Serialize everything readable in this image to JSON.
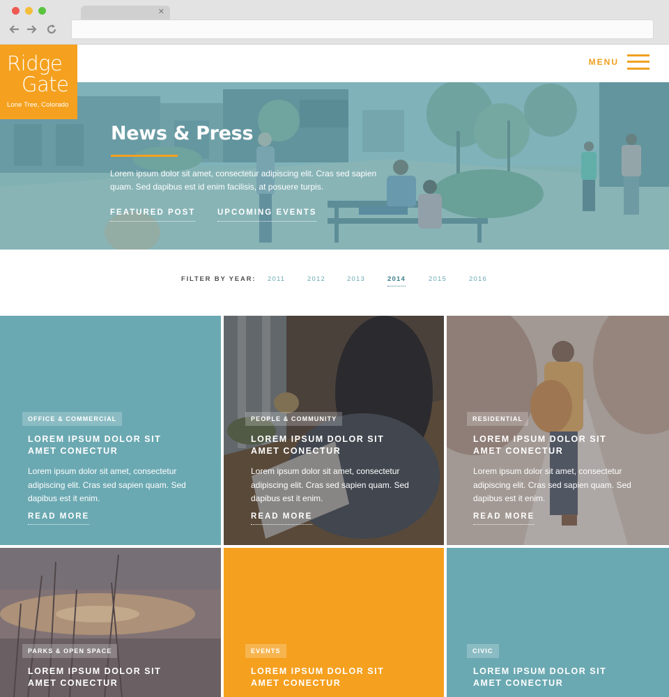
{
  "brand": {
    "name_line1": "Ridge",
    "name_line2": "Gate",
    "location": "Lone Tree, Colorado"
  },
  "header": {
    "menu_label": "MENU"
  },
  "hero": {
    "title": "News & Press",
    "description": "Lorem ipsum dolor sit amet, consectetur adipiscing elit. Cras sed sapien quam. Sed dapibus est id enim facilisis, at posuere turpis.",
    "links": [
      "FEATURED POST",
      "UPCOMING EVENTS"
    ]
  },
  "filter": {
    "label": "FILTER BY YEAR:",
    "years": [
      "2011",
      "2012",
      "2013",
      "2014",
      "2015",
      "2016"
    ],
    "active": "2014"
  },
  "tiles": [
    {
      "category": "OFFICE & COMMERCIAL",
      "title_line1": "LOREM IPSUM DOLOR SIT",
      "title_line2": "AMET CONECTUR",
      "text": "Lorem ipsum dolor sit amet, consectetur adipiscing elit. Cras sed sapien quam. Sed dapibus est it enim.",
      "more": "READ MORE"
    },
    {
      "category": "PEOPLE & COMMUNITY",
      "title_line1": "LOREM IPSUM DOLOR SIT",
      "title_line2": "AMET CONECTUR",
      "text": "Lorem ipsum dolor sit amet, consectetur adipiscing elit. Cras sed sapien quam. Sed dapibus est it enim.",
      "more": "READ MORE"
    },
    {
      "category": "RESIDENTIAL",
      "title_line1": "LOREM IPSUM DOLOR SIT",
      "title_line2": "AMET CONECTUR",
      "text": "Lorem ipsum dolor sit amet, consectetur adipiscing elit. Cras sed sapien quam. Sed dapibus est it enim.",
      "more": "READ MORE"
    },
    {
      "category": "PARKS & OPEN SPACE",
      "title_line1": "LOREM IPSUM DOLOR SIT",
      "title_line2": "AMET CONECTUR"
    },
    {
      "category": "EVENTS",
      "title_line1": "LOREM IPSUM DOLOR SIT",
      "title_line2": "AMET CONECTUR"
    },
    {
      "category": "CIVIC",
      "title_line1": "LOREM IPSUM DOLOR SIT",
      "title_line2": "AMET CONECTUR"
    }
  ],
  "colors": {
    "brand_orange": "#f5a11f",
    "teal": "#6ba9b2",
    "tile_orange": "#f5a01f"
  }
}
